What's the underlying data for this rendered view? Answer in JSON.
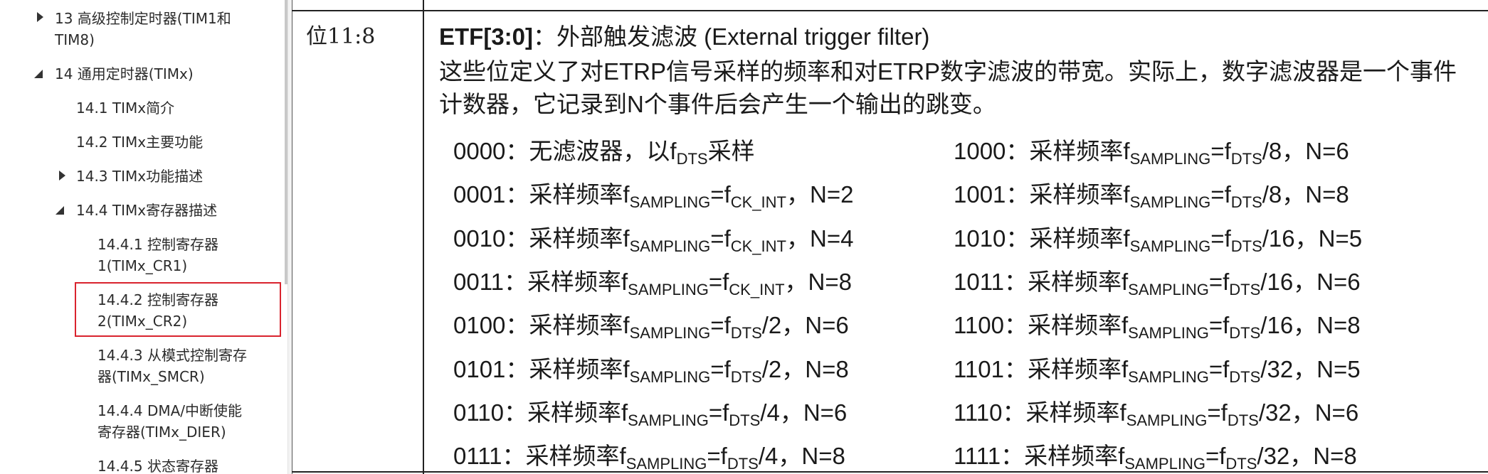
{
  "sidebar": {
    "items": [
      {
        "label_1": "13 高级控制定时器(TIM1和",
        "label_2": "TIM8)"
      },
      {
        "label_1": "14 通用定时器(TIMx)"
      },
      {
        "label_1": "14.1 TIMx简介"
      },
      {
        "label_1": "14.2 TIMx主要功能"
      },
      {
        "label_1": "14.3 TIMx功能描述"
      },
      {
        "label_1": "14.4 TIMx寄存器描述"
      },
      {
        "label_1": "14.4.1 控制寄存器",
        "label_2": "1(TIMx_CR1)"
      },
      {
        "label_1": "14.4.2 控制寄存器",
        "label_2": "2(TIMx_CR2)"
      },
      {
        "label_1": "14.4.3 从模式控制寄存",
        "label_2": "器(TIMx_SMCR)"
      },
      {
        "label_1": "14.4.4 DMA/中断使能",
        "label_2": "寄存器(TIMx_DIER)"
      },
      {
        "label_1": "14.4.5 状态寄存器"
      }
    ]
  },
  "doc": {
    "bits": "位11:8",
    "heading_bold": "ETF[3:0]",
    "heading_rest": "：外部触发滤波 (External trigger filter)",
    "description": "这些位定义了对ETRP信号采样的频率和对ETRP数字滤波的带宽。实际上，数字滤波器是一个事件计数器，它记录到N个事件后会产生一个输出的跳变。",
    "sub_sampling": "SAMPLING",
    "sub_dts": "DTS",
    "sub_ckint": "CK_INT",
    "left_rows": [
      {
        "code": "0000：",
        "pre": "无滤波器，以f",
        "suf": "采样"
      },
      {
        "code": "0001：",
        "pre": "采样频率f",
        "mid": "=f",
        "suf": "，N=2"
      },
      {
        "code": "0010：",
        "pre": "采样频率f",
        "mid": "=f",
        "suf": "，N=4"
      },
      {
        "code": "0011：",
        "pre": "采样频率f",
        "mid": "=f",
        "suf": "，N=8"
      },
      {
        "code": "0100：",
        "pre": "采样频率f",
        "mid": "=f",
        "suf": "/2，N=6"
      },
      {
        "code": "0101：",
        "pre": "采样频率f",
        "mid": "=f",
        "suf": "/2，N=8"
      },
      {
        "code": "0110：",
        "pre": "采样频率f",
        "mid": "=f",
        "suf": "/4，N=6"
      },
      {
        "code": "0111：",
        "pre": "采样频率f",
        "mid": "=f",
        "suf": "/4，N=8"
      }
    ],
    "right_rows": [
      {
        "code": "1000：",
        "pre": "采样频率f",
        "mid": "=f",
        "suf": "/8，N=6"
      },
      {
        "code": "1001：",
        "pre": "采样频率f",
        "mid": "=f",
        "suf": "/8，N=8"
      },
      {
        "code": "1010：",
        "pre": "采样频率f",
        "mid": "=f",
        "suf": "/16，N=5"
      },
      {
        "code": "1011：",
        "pre": "采样频率f",
        "mid": "=f",
        "suf": "/16，N=6"
      },
      {
        "code": "1100：",
        "pre": "采样频率f",
        "mid": "=f",
        "suf": "/16，N=8"
      },
      {
        "code": "1101：",
        "pre": "采样频率f",
        "mid": "=f",
        "suf": "/32，N=5"
      },
      {
        "code": "1110：",
        "pre": "采样频率f",
        "mid": "=f",
        "suf": "/32，N=6"
      },
      {
        "code": "1111：",
        "pre": "采样频率f",
        "mid": "=f",
        "suf": "/32，N=8"
      }
    ]
  }
}
